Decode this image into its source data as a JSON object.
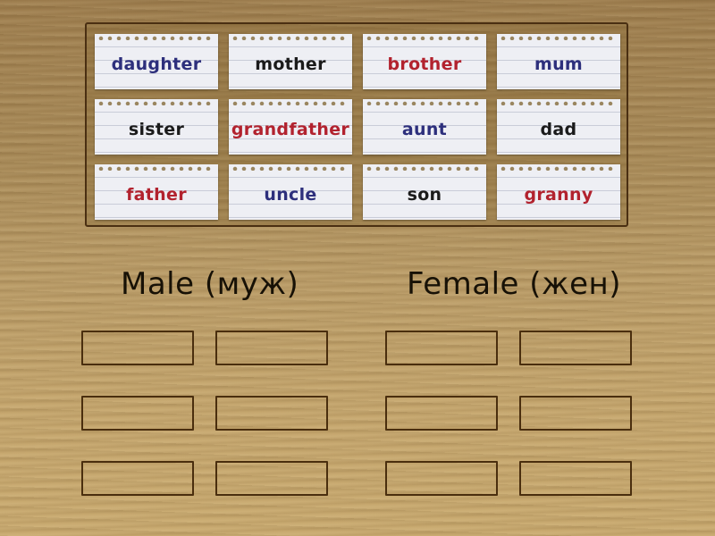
{
  "cards": [
    {
      "word": "daughter",
      "color": "#2d2f7c"
    },
    {
      "word": "mother",
      "color": "#1b1b1b"
    },
    {
      "word": "brother",
      "color": "#b2222e"
    },
    {
      "word": "mum",
      "color": "#2d2f7c"
    },
    {
      "word": "sister",
      "color": "#1b1b1b"
    },
    {
      "word": "grandfather",
      "color": "#b2222e"
    },
    {
      "word": "aunt",
      "color": "#2d2f7c"
    },
    {
      "word": "dad",
      "color": "#1b1b1b"
    },
    {
      "word": "father",
      "color": "#b2222e"
    },
    {
      "word": "uncle",
      "color": "#2d2f7c"
    },
    {
      "word": "son",
      "color": "#1b1b1b"
    },
    {
      "word": "granny",
      "color": "#b2222e"
    }
  ],
  "groups": [
    {
      "label": "Male (муж)",
      "slots": 6
    },
    {
      "label": "Female (жен)",
      "slots": 6
    }
  ]
}
